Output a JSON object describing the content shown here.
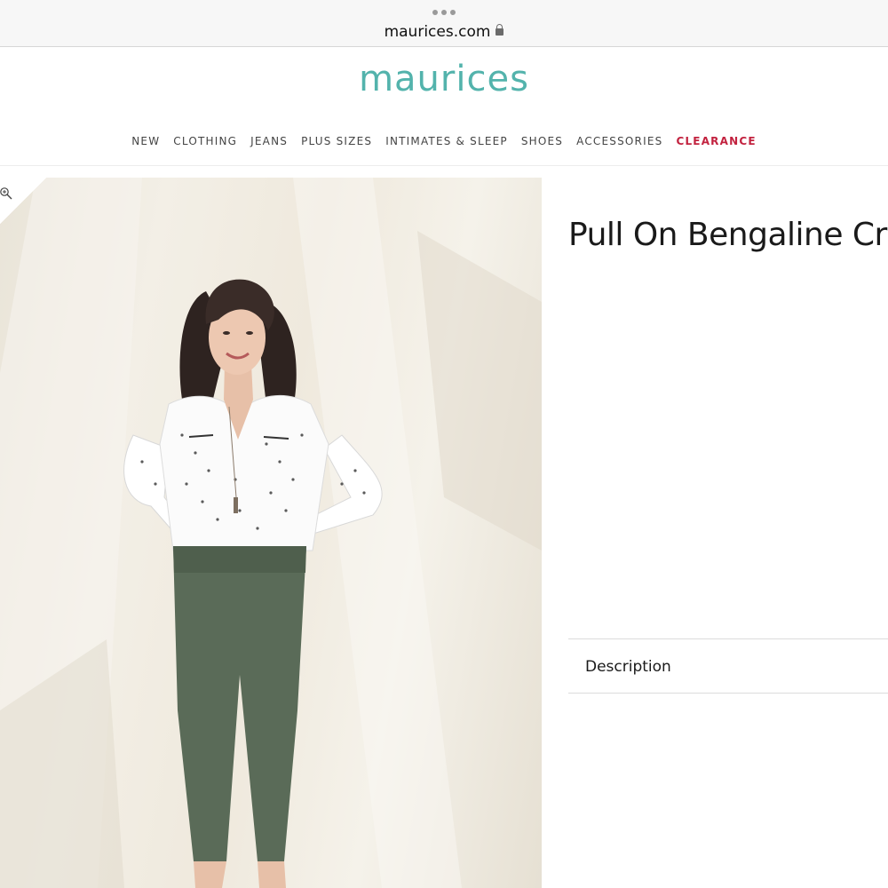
{
  "browser": {
    "url": "maurices.com",
    "lock_icon": "lock-icon",
    "menu_icon": "more-dots-icon"
  },
  "site": {
    "logo": "maurices",
    "brand_color": "#53b3ac",
    "clearance_color": "#c2223f"
  },
  "nav": {
    "items": [
      {
        "label": "NEW"
      },
      {
        "label": "CLOTHING"
      },
      {
        "label": "JEANS"
      },
      {
        "label": "PLUS SIZES"
      },
      {
        "label": "INTIMATES & SLEEP"
      },
      {
        "label": "SHOES"
      },
      {
        "label": "ACCESSORIES"
      },
      {
        "label": "CLEARANCE"
      }
    ]
  },
  "product": {
    "title": "Pull On Bengaline Crop",
    "image_icon": "zoom-in-icon",
    "description_label": "Description"
  }
}
